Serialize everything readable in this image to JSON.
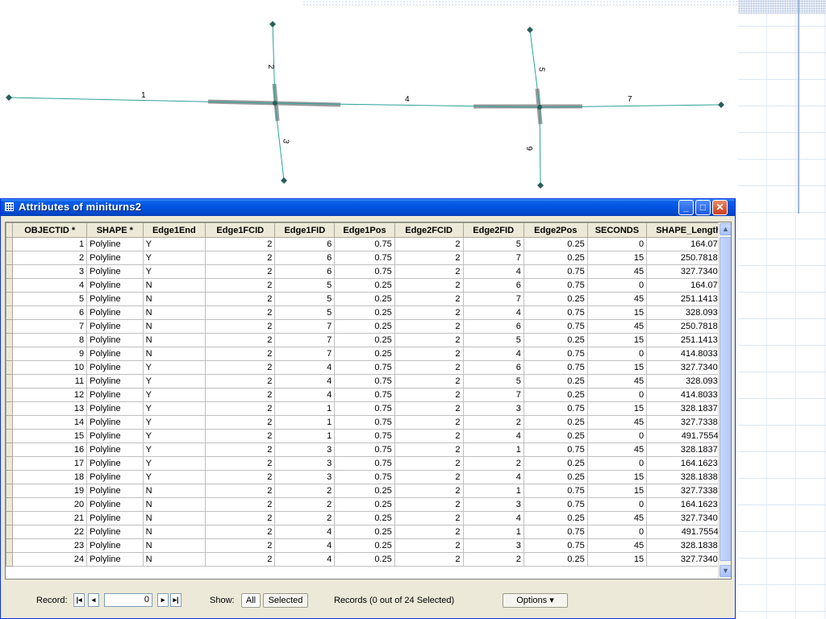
{
  "window": {
    "title": "Attributes of miniturns2",
    "minimize_label": "_",
    "maximize_label": "□",
    "close_label": "✕"
  },
  "map": {
    "edge_labels": [
      "1",
      "2",
      "3",
      "4",
      "5",
      "6",
      "7"
    ]
  },
  "table": {
    "columns": [
      "OBJECTID *",
      "SHAPE *",
      "Edge1End",
      "Edge1FCID",
      "Edge1FID",
      "Edge1Pos",
      "Edge2FCID",
      "Edge2FID",
      "Edge2Pos",
      "SECONDS",
      "SHAPE_Length"
    ],
    "rows": [
      [
        "1",
        "Polyline",
        "Y",
        "2",
        "6",
        "0.75",
        "2",
        "5",
        "0.25",
        "0",
        "164.0721"
      ],
      [
        "2",
        "Polyline",
        "Y",
        "2",
        "6",
        "0.75",
        "2",
        "7",
        "0.25",
        "15",
        "250.781824"
      ],
      [
        "3",
        "Polyline",
        "Y",
        "2",
        "6",
        "0.75",
        "2",
        "4",
        "0.75",
        "45",
        "327.734065"
      ],
      [
        "4",
        "Polyline",
        "N",
        "2",
        "5",
        "0.25",
        "2",
        "6",
        "0.75",
        "0",
        "164.0721"
      ],
      [
        "5",
        "Polyline",
        "N",
        "2",
        "5",
        "0.25",
        "2",
        "7",
        "0.25",
        "45",
        "251.141379"
      ],
      [
        "6",
        "Polyline",
        "N",
        "2",
        "5",
        "0.25",
        "2",
        "4",
        "0.75",
        "15",
        "328.09362"
      ],
      [
        "7",
        "Polyline",
        "N",
        "2",
        "7",
        "0.25",
        "2",
        "6",
        "0.75",
        "45",
        "250.781824"
      ],
      [
        "8",
        "Polyline",
        "N",
        "2",
        "7",
        "0.25",
        "2",
        "5",
        "0.25",
        "15",
        "251.141379"
      ],
      [
        "9",
        "Polyline",
        "N",
        "2",
        "7",
        "0.25",
        "2",
        "4",
        "0.75",
        "0",
        "414.803344"
      ],
      [
        "10",
        "Polyline",
        "Y",
        "2",
        "4",
        "0.75",
        "2",
        "6",
        "0.75",
        "15",
        "327.734065"
      ],
      [
        "11",
        "Polyline",
        "Y",
        "2",
        "4",
        "0.75",
        "2",
        "5",
        "0.25",
        "45",
        "328.09362"
      ],
      [
        "12",
        "Polyline",
        "Y",
        "2",
        "4",
        "0.75",
        "2",
        "7",
        "0.25",
        "0",
        "414.803344"
      ],
      [
        "13",
        "Polyline",
        "Y",
        "2",
        "1",
        "0.75",
        "2",
        "3",
        "0.75",
        "15",
        "328.183703"
      ],
      [
        "14",
        "Polyline",
        "Y",
        "2",
        "1",
        "0.75",
        "2",
        "2",
        "0.25",
        "45",
        "327.733847"
      ],
      [
        "15",
        "Polyline",
        "Y",
        "2",
        "1",
        "0.75",
        "2",
        "4",
        "0.25",
        "0",
        "491.755411"
      ],
      [
        "16",
        "Polyline",
        "Y",
        "2",
        "3",
        "0.75",
        "2",
        "1",
        "0.75",
        "45",
        "328.183703"
      ],
      [
        "17",
        "Polyline",
        "Y",
        "2",
        "3",
        "0.75",
        "2",
        "2",
        "0.25",
        "0",
        "164.162314"
      ],
      [
        "18",
        "Polyline",
        "Y",
        "2",
        "3",
        "0.75",
        "2",
        "4",
        "0.25",
        "15",
        "328.183877"
      ],
      [
        "19",
        "Polyline",
        "N",
        "2",
        "2",
        "0.25",
        "2",
        "1",
        "0.75",
        "15",
        "327.733847"
      ],
      [
        "20",
        "Polyline",
        "N",
        "2",
        "2",
        "0.25",
        "2",
        "3",
        "0.75",
        "0",
        "164.162314"
      ],
      [
        "21",
        "Polyline",
        "N",
        "2",
        "2",
        "0.25",
        "2",
        "4",
        "0.25",
        "45",
        "327.734021"
      ],
      [
        "22",
        "Polyline",
        "N",
        "2",
        "4",
        "0.25",
        "2",
        "1",
        "0.75",
        "0",
        "491.755411"
      ],
      [
        "23",
        "Polyline",
        "N",
        "2",
        "4",
        "0.25",
        "2",
        "3",
        "0.75",
        "45",
        "328.183877"
      ],
      [
        "24",
        "Polyline",
        "N",
        "2",
        "4",
        "0.25",
        "2",
        "2",
        "0.25",
        "15",
        "327.734021"
      ]
    ]
  },
  "footer": {
    "record_label": "Record:",
    "record_value": "0",
    "first_label": "|◂",
    "prev_label": "◂",
    "next_label": "▸",
    "last_label": "▸|",
    "show_label": "Show:",
    "all_label": "All",
    "selected_label": "Selected",
    "records_status": "Records (0 out of 24 Selected)",
    "options_label": "Options ▾"
  },
  "colors": {
    "titlebar": "#0054e3",
    "edge_line": "#2aa198",
    "turn_feature": "#9a9a9a"
  }
}
